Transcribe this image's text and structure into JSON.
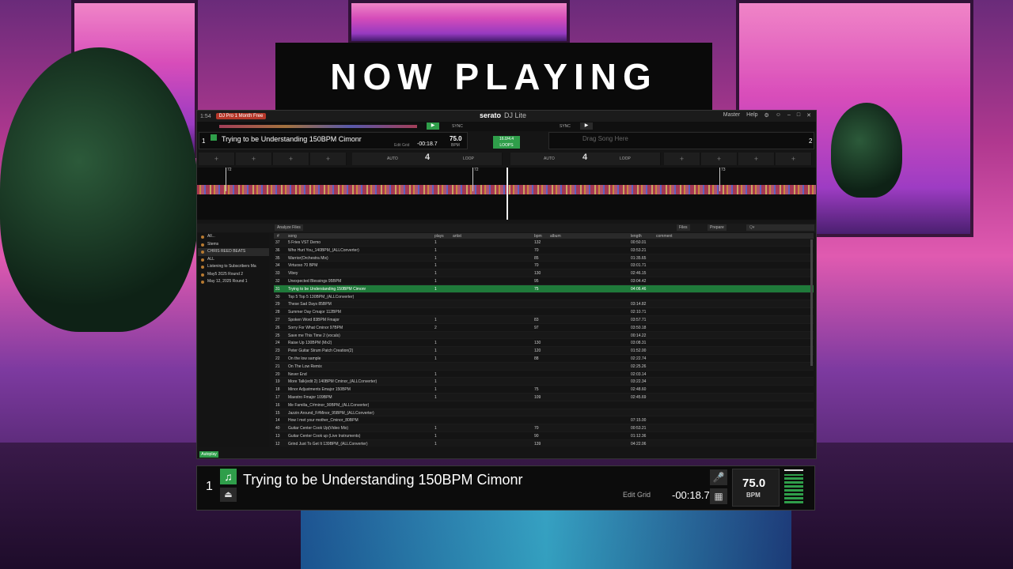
{
  "overlay": {
    "heading": "NOW PLAYING"
  },
  "app": {
    "clock": "1:54",
    "pro_badge": "DJ Pro 1 Month Free",
    "logo_brand": "serato",
    "logo_product": "DJ Lite",
    "top_right": {
      "master": "Master",
      "help": "Help",
      "gear": "⚙",
      "account": "☺"
    },
    "sync_label": "SYNC"
  },
  "deck_left": {
    "number": "1",
    "title": "Trying to be Understanding 150BPM Cimonr",
    "edit_grid": "Edit Grid",
    "time": "-00:18.7",
    "bpm": "75.0",
    "bpm_label": "BPM"
  },
  "deck_right": {
    "number": "2",
    "placeholder": "Drag Song Here"
  },
  "center": {
    "loop_label": "16.0/4.4 LOOPS"
  },
  "pads": {
    "auto": "AUTO",
    "loop": "LOOP",
    "loop_size_left": "4",
    "loop_size_right": "4",
    "plus": "+"
  },
  "cue_labels": [
    "72",
    "72",
    "73"
  ],
  "library": {
    "analyze_btn": "Analyze Files",
    "files_btn": "Files",
    "prepare_btn": "Prepare",
    "search_placeholder": "Q▾",
    "autoplay": "Autoplay"
  },
  "crates": [
    {
      "name": "All..."
    },
    {
      "name": "Stems"
    },
    {
      "name": "CHRIS REED BEATS"
    },
    {
      "name": "ALL"
    },
    {
      "name": "Listening to Subscribers  Ma"
    },
    {
      "name": "May5 2025  Round 2"
    },
    {
      "name": "May 12, 2025 Round 1"
    }
  ],
  "columns": {
    "num": "#",
    "song": "song",
    "plays": "plays",
    "artist": "artist",
    "bpm": "bpm",
    "album": "album",
    "length": "length",
    "comment": "comment"
  },
  "tracks": [
    {
      "num": "37",
      "song": "5 Fries VST Demo",
      "plays": "1",
      "bpm": "132",
      "length": "00:50.01"
    },
    {
      "num": "36",
      "song": "Who Hurt You_140BPM_(ALLConverter)",
      "plays": "1",
      "bpm": "70",
      "length": "03:53.21"
    },
    {
      "num": "35",
      "song": "Warrior(Orchestra Mix)",
      "plays": "1",
      "bpm": "85",
      "length": "01:35.65"
    },
    {
      "num": "34",
      "song": "Virtuoso 70 BPM",
      "plays": "1",
      "bpm": "70",
      "length": "03:01.71"
    },
    {
      "num": "33",
      "song": "Vibey",
      "plays": "1",
      "bpm": "130",
      "length": "02:46.15"
    },
    {
      "num": "32",
      "song": "Unexpected Blessings 95BPM",
      "plays": "1",
      "bpm": "95",
      "length": "03:04.42"
    },
    {
      "num": "31",
      "song": "Trying to be Understanding 150BPM Cimonr",
      "plays": "1",
      "bpm": "75",
      "length": "04:06.46",
      "playing": true
    },
    {
      "num": "30",
      "song": "Top 5 Top 5 130BPM_(ALLConverter)",
      "plays": "",
      "bpm": "",
      "length": ""
    },
    {
      "num": "29",
      "song": "These Sad Days 85BPM",
      "plays": "",
      "bpm": "",
      "length": "03:14.82"
    },
    {
      "num": "28",
      "song": "Summer Day Cmajor 112BPM",
      "plays": "",
      "bpm": "",
      "length": "02:10.71"
    },
    {
      "num": "27",
      "song": "Spoken Word 83BPM Fmajor",
      "plays": "1",
      "bpm": "83",
      "length": "03:57.71"
    },
    {
      "num": "26",
      "song": "Sorry For What Cminor 97BPM",
      "plays": "2",
      "bpm": "97",
      "length": "03:50.18"
    },
    {
      "num": "25",
      "song": "Save me This Time 2 (vocals)",
      "plays": "",
      "bpm": "",
      "length": "00:14.22"
    },
    {
      "num": "24",
      "song": "Raise Up 130BPM (Mx2)",
      "plays": "1",
      "bpm": "130",
      "length": "03:08.31"
    },
    {
      "num": "23",
      "song": "Peter Guitar Strum Patch Creation(2)",
      "plays": "1",
      "bpm": "120",
      "length": "01:52.00"
    },
    {
      "num": "22",
      "song": "On the low sample",
      "plays": "1",
      "bpm": "88",
      "length": "02:22.74"
    },
    {
      "num": "21",
      "song": "On The Low Remix",
      "plays": "",
      "bpm": "",
      "length": "02:25.26"
    },
    {
      "num": "20",
      "song": "Never End",
      "plays": "1",
      "bpm": "",
      "length": "02:03.14"
    },
    {
      "num": "19",
      "song": "More Talk(edit 2) 140BPM Cminor_(ALLConverter)",
      "plays": "1",
      "bpm": "",
      "length": "03:22.34"
    },
    {
      "num": "18",
      "song": "Minor Adjustments Emajor 150BPM",
      "plays": "1",
      "bpm": "75",
      "length": "02:48.60"
    },
    {
      "num": "17",
      "song": "Maestro Fmajor 109BPM",
      "plays": "1",
      "bpm": "109",
      "length": "02:45.69"
    },
    {
      "num": "16",
      "song": "Me Familia_C#minor_90BPM_(ALLConverter)",
      "plays": "",
      "bpm": "",
      "length": ""
    },
    {
      "num": "15",
      "song": "Jazzin Around_F#Minor_95BPM_(ALLConverter)",
      "plays": "",
      "bpm": "",
      "length": ""
    },
    {
      "num": "14",
      "song": "How I met your mother_Cminor_80BPM",
      "plays": "",
      "bpm": "",
      "length": "07:15.00"
    },
    {
      "num": "40",
      "song": "Guitar Center Cook Up(Video Mix)",
      "plays": "1",
      "bpm": "70",
      "length": "00:53.21"
    },
    {
      "num": "13",
      "song": "Guitar Center Cook up (Live Instruments)",
      "plays": "1",
      "bpm": "90",
      "length": "01:12.36"
    },
    {
      "num": "12",
      "song": "Grind Just To Get It 139BPM_(ALLConverter)",
      "plays": "1",
      "bpm": "139",
      "length": "04:22.06"
    }
  ],
  "zoom_deck": {
    "number": "1",
    "note_icon": "♫",
    "eject_icon": "⏏",
    "title": "Trying to be Understanding 150BPM Cimonr",
    "edit_grid": "Edit Grid",
    "time": "-00:18.7",
    "bpm": "75.0",
    "bpm_label": "BPM",
    "mic_icon": "🎤",
    "grid_icon": "▦"
  }
}
